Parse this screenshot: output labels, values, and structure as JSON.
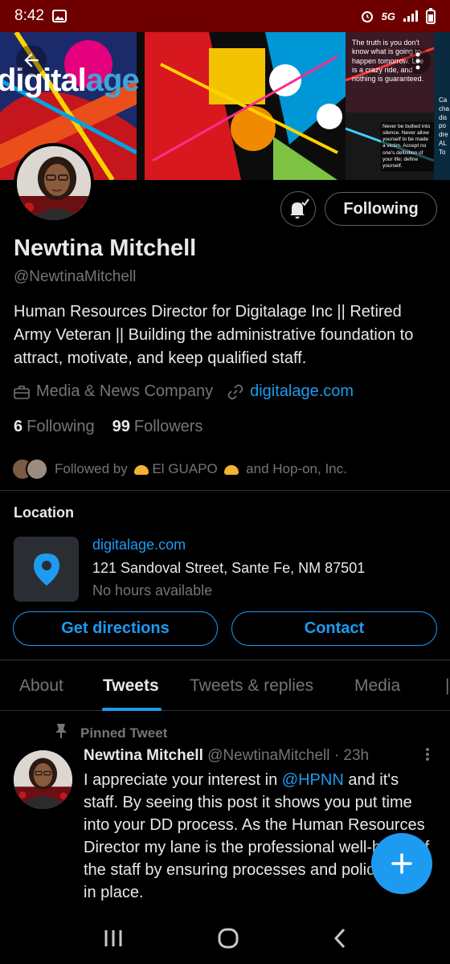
{
  "status_bar": {
    "time": "8:42",
    "network": "5G"
  },
  "banner": {
    "logo_prefix": "digital",
    "logo_suffix": "age",
    "quote_main": "The truth is you don't know what is going to happen tomorrow. Life is a crazy ride, and nothing is guaranteed.",
    "quote_small": "Never be bullied into silence. Never allow yourself to be made a victim. Accept no one's definition of your life; define yourself.",
    "side_text": "Ca cha dis po dre AL To"
  },
  "profile": {
    "name": "Newtina Mitchell",
    "handle": "@NewtinaMitchell",
    "bio": "Human Resources Director for Digitalage Inc || Retired Army Veteran || Building the administrative foundation to attract, motivate, and keep qualified staff.",
    "category": "Media & News Company",
    "website": "digitalage.com",
    "following_count": "6",
    "following_label": "Following",
    "followers_count": "99",
    "followers_label": "Followers",
    "followed_by_prefix": "Followed by",
    "followed_by_name1": "El GUAPO",
    "followed_by_joiner": "and Hop-on, Inc."
  },
  "buttons": {
    "following": "Following",
    "get_directions": "Get directions",
    "contact": "Contact"
  },
  "location": {
    "title": "Location",
    "website": "digitalage.com",
    "address": "121 Sandoval Street, Sante Fe, NM 87501",
    "hours": "No hours available"
  },
  "tabs": [
    {
      "label": "About"
    },
    {
      "label": "Tweets"
    },
    {
      "label": "Tweets & replies"
    },
    {
      "label": "Media"
    }
  ],
  "tweet": {
    "pinned_label": "Pinned Tweet",
    "author": "Newtina Mitchell",
    "handle": "@NewtinaMitchell",
    "time": "· 23h",
    "text_before": "I appreciate your interest in ",
    "mention": "@HPNN",
    "text_after": " and it's staff. By seeing this post it shows you put time into your DD process. As the Human Resources Director my lane is the professional well-being of the staff by ensuring processes and policies are in place."
  },
  "colors": {
    "accent": "#1d9bf0",
    "status_bar": "#6e0000",
    "background": "#000000",
    "muted": "#71767b"
  },
  "icons": [
    "back-arrow-icon",
    "more-vertical-icon",
    "bell-check-icon",
    "briefcase-icon",
    "link-icon",
    "map-pin-icon",
    "pin-icon",
    "plus-icon",
    "recents-icon",
    "home-icon",
    "back-nav-icon"
  ]
}
